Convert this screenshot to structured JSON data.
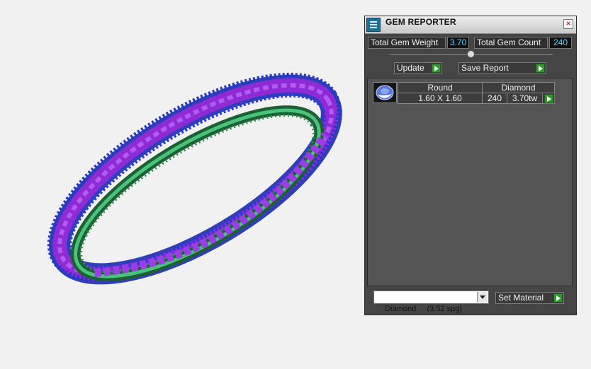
{
  "viewport": {
    "model": "eternity-band-render"
  },
  "panel": {
    "title": "GEM REPORTER",
    "close_icon": "close-icon",
    "app_icon": "gem-reporter-icon",
    "total_weight_label": "Total Gem Weight",
    "total_weight_value": "3.70",
    "total_count_label": "Total Gem Count",
    "total_count_value": "240",
    "update_label": "Update",
    "save_report_label": "Save Report",
    "gem_list": {
      "headers": {
        "shape": "Round",
        "material": "Diamond"
      },
      "rows": [
        {
          "size": "1.60 X 1.60",
          "count": "240",
          "weight": "3.70tw"
        }
      ]
    },
    "material_select": {
      "value": "Diamond     (3.52 spg)"
    },
    "set_material_label": "Set Material"
  },
  "colors": {
    "panel_bg": "#454545",
    "value_text": "#5fd0ff",
    "go_button": "#2f9a2c",
    "gem_purple": "#9c2fe6",
    "gem_blue": "#2f3fd0",
    "metal_green": "#2fa85a"
  }
}
